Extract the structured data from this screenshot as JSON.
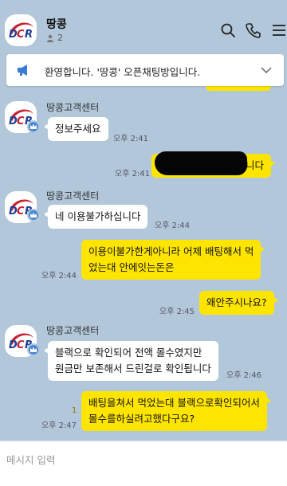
{
  "header": {
    "title": "땅콩",
    "member_count": "2",
    "icons": [
      "search-icon",
      "phone-icon",
      "menu-icon"
    ]
  },
  "notice": {
    "text": "환영합니다. '땅콩' 오픈채팅방입니다.",
    "icon": "megaphone-icon"
  },
  "messages": [
    {
      "sender": "땅콩고객센터",
      "text": "정보주세요",
      "time": "오후 2:41",
      "direction": "in"
    },
    {
      "text": "니다",
      "time": "오후 2:41",
      "direction": "out",
      "redacted": true
    },
    {
      "sender": "땅콩고객센터",
      "text": "네 이용불가하십니다",
      "time": "오후 2:44",
      "direction": "in"
    },
    {
      "lines": [
        "이용이불가한게아니라 어제 배팅해서 먹",
        "었는대 안에잇는돈은"
      ],
      "time": "오후 2:44",
      "direction": "out"
    },
    {
      "text": "왜안주시나요?",
      "time": "오후 2:45",
      "direction": "out"
    },
    {
      "sender": "땅콩고객센터",
      "lines": [
        "블랙으로 확인되어 전액 몰수였지만",
        "원금만 보존해서 드린걸로 확인됩니다"
      ],
      "time": "오후 2:46",
      "direction": "in"
    },
    {
      "lines": [
        "배팅을쳐서 먹었는대 블랙으로확인되어서",
        "몰수를하실려고했다구요?"
      ],
      "time": "오후 2:47",
      "direction": "out",
      "unread": "1"
    }
  ],
  "input": {
    "placeholder": "메시지 입력"
  },
  "colors": {
    "background": "#b2c7d9",
    "outgoing_bubble": "#fee500",
    "incoming_bubble": "#ffffff",
    "badge": "#4a87d6"
  }
}
